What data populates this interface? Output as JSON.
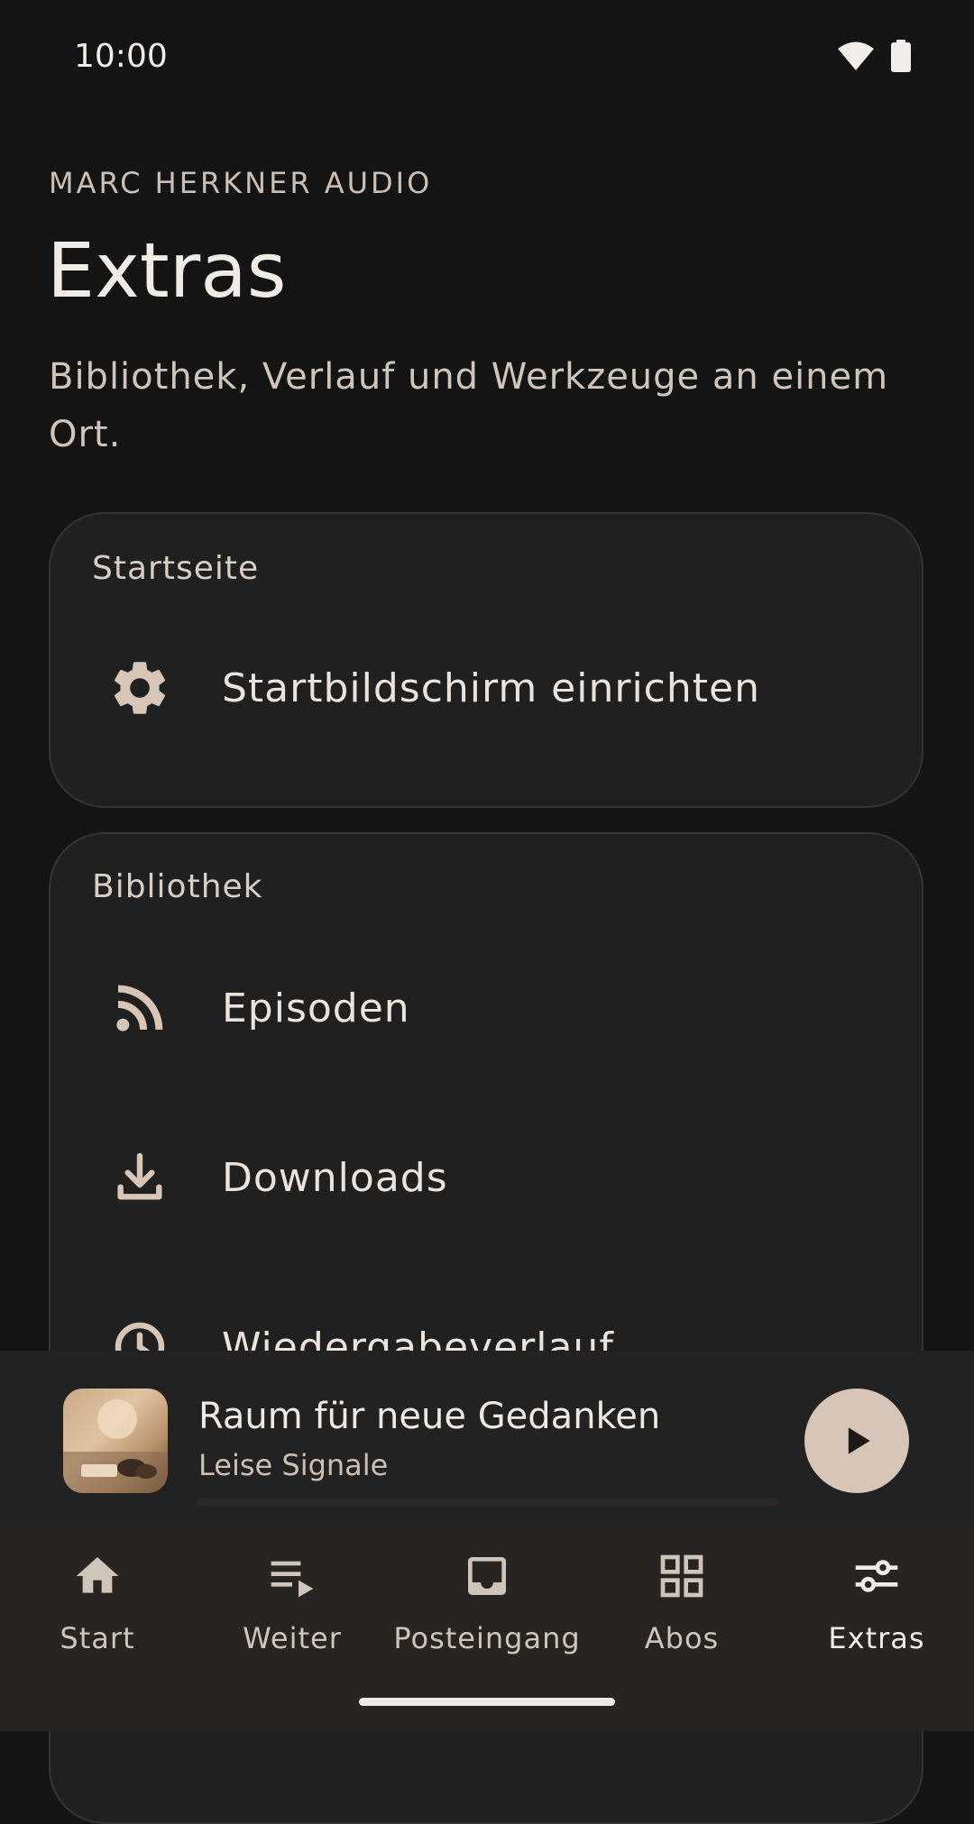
{
  "status": {
    "time": "10:00"
  },
  "header": {
    "kicker": "MARC HERKNER AUDIO",
    "title": "Extras",
    "subtitle": "Bibliothek, Verlauf und Werkzeuge an einem Ort."
  },
  "sections": [
    {
      "label": "Startseite",
      "items": [
        {
          "label": "Startbildschirm einrichten",
          "icon": "gear-icon"
        }
      ]
    },
    {
      "label": "Bibliothek",
      "items": [
        {
          "label": "Episoden",
          "icon": "rss-icon"
        },
        {
          "label": "Downloads",
          "icon": "download-icon"
        },
        {
          "label": "Wiedergabeverlauf",
          "icon": "history-icon"
        }
      ]
    }
  ],
  "player": {
    "title": "Raum für neue Gedanken",
    "subtitle": "Leise Signale",
    "progress": 0.0
  },
  "nav": [
    {
      "label": "Start",
      "icon": "home-icon"
    },
    {
      "label": "Weiter",
      "icon": "queue-icon"
    },
    {
      "label": "Posteingang",
      "icon": "inbox-icon"
    },
    {
      "label": "Abos",
      "icon": "grid-icon"
    },
    {
      "label": "Extras",
      "icon": "sliders-icon",
      "active": true
    }
  ],
  "colors": {
    "accent": "#d7c5b8",
    "background": "#141414",
    "card": "#202020"
  }
}
